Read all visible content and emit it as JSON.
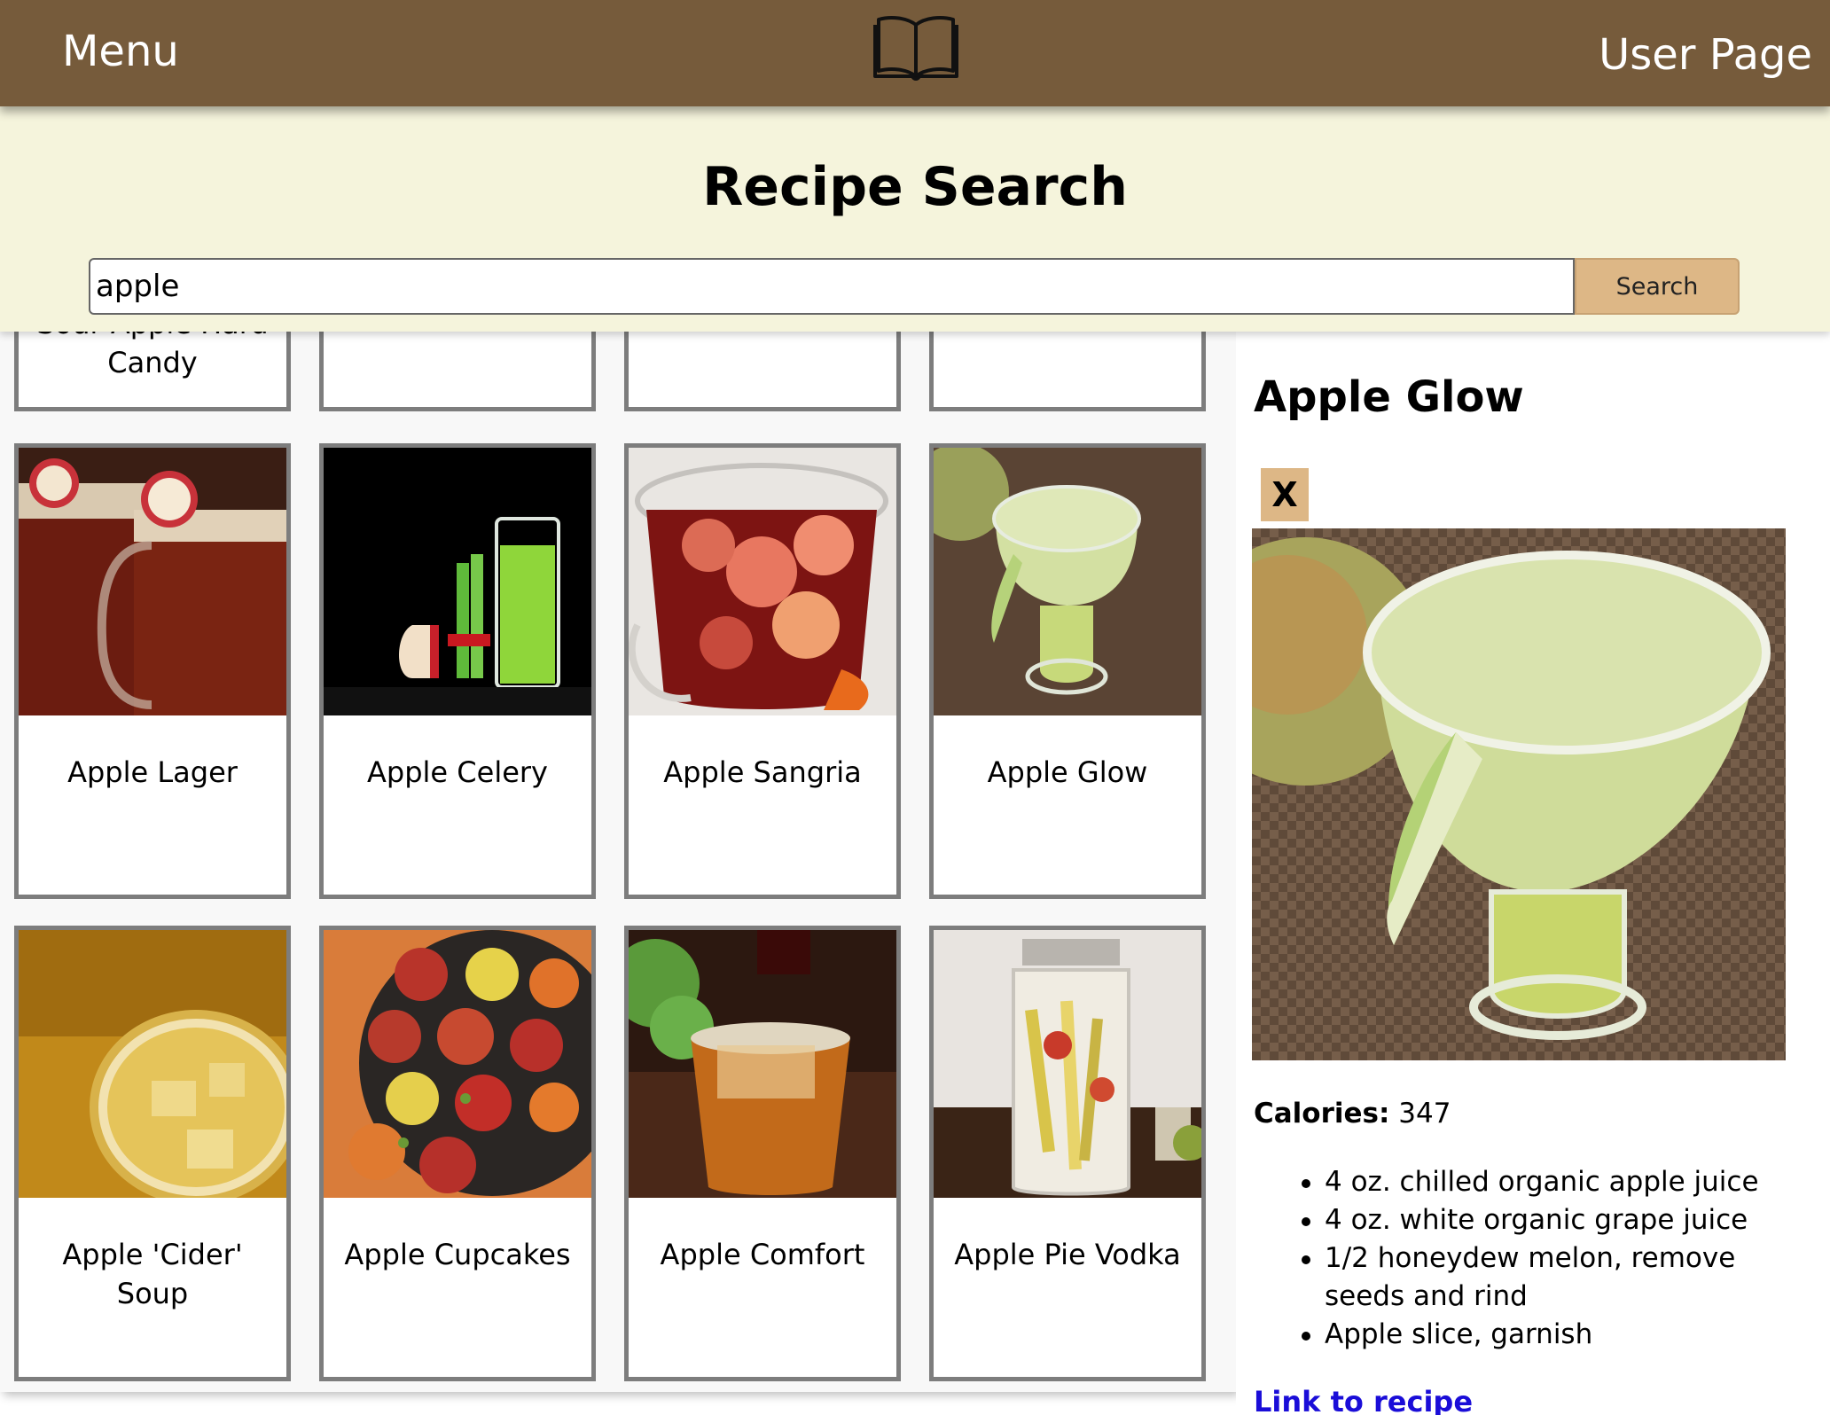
{
  "nav": {
    "menu_label": "Menu",
    "user_label": "User Page",
    "logo_icon": "open-book-icon",
    "bar_color": "#765b3b"
  },
  "search": {
    "title": "Recipe Search",
    "query": "apple",
    "button_label": "Search",
    "header_bg": "#f5f4dc",
    "button_color": "#ddb786"
  },
  "results": {
    "partial_row": [
      "Sour Apple Hard Candy",
      "",
      "",
      ""
    ],
    "cards": [
      {
        "label": "Apple Lager",
        "image": "beer-mugs-with-apple-slices"
      },
      {
        "label": "Apple Celery",
        "image": "green-juice-with-celery"
      },
      {
        "label": "Apple Sangria",
        "image": "sangria-pitcher-with-apples"
      },
      {
        "label": "Apple Glow",
        "image": "green-cocktail-with-apple-slice"
      },
      {
        "label": "Apple 'Cider' Soup",
        "image": "bowl-of-cider-soup"
      },
      {
        "label": "Apple Cupcakes",
        "image": "autumn-leaf-cupcakes"
      },
      {
        "label": "Apple Comfort",
        "image": "amber-drink-in-glass"
      },
      {
        "label": "Apple Pie Vodka",
        "image": "mason-jar-with-apples"
      }
    ]
  },
  "detail": {
    "title": "Apple Glow",
    "close_label": "X",
    "image": "green-cocktail-with-apple-slice",
    "calories_label": "Calories:",
    "calories_value": "347",
    "ingredients": [
      "4 oz. chilled organic apple juice",
      "4 oz. white organic grape juice",
      "1/2 honeydew melon, remove seeds and rind",
      "Apple slice, garnish"
    ],
    "link_label": "Link to recipe",
    "link_color": "#1a0dd8"
  }
}
